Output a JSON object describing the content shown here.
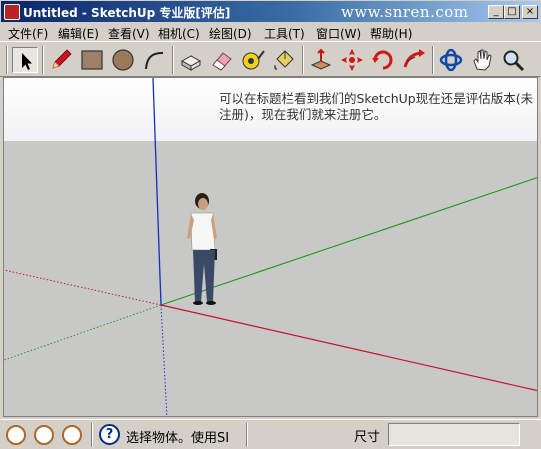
{
  "window": {
    "title": "Untitled - SketchUp 专业版[评估]",
    "watermark": "www.snren.com",
    "controls": [
      "_",
      "□",
      "×"
    ]
  },
  "menu": [
    {
      "label": "文件(F)"
    },
    {
      "label": "编辑(E)"
    },
    {
      "label": "查看(V)"
    },
    {
      "label": "相机(C)"
    },
    {
      "label": "绘图(D)"
    },
    {
      "label": "工具(T)"
    },
    {
      "label": "窗口(W)"
    },
    {
      "label": "帮助(H)"
    }
  ],
  "toolbar": {
    "tools": [
      "select-arrow-icon",
      "pencil-icon",
      "rectangle-icon",
      "circle-icon",
      "arc-icon",
      "make-component-icon",
      "eraser-icon",
      "tape-measure-icon",
      "paint-bucket-icon",
      "push-pull-icon",
      "move-icon",
      "rotate-icon",
      "follow-me-icon",
      "orbit-icon",
      "pan-hand-icon",
      "zoom-icon"
    ],
    "selected": "select-arrow-icon"
  },
  "viewport": {
    "annotation": "可以在标题栏看到我们的SketchUp现在还是评估版本(未注册)，现在我们就来注册它。"
  },
  "statusbar": {
    "message": "选择物体。使用SI",
    "measurement_label": "尺寸",
    "measurement_value": "",
    "buttons": [
      "geo-location-icon",
      "credits-icon",
      "user-icon"
    ]
  },
  "colors": {
    "red_axis": "#c8102e",
    "green_axis": "#1a9a1a",
    "blue_axis": "#1030c0",
    "titlebar": "#0a246a"
  }
}
